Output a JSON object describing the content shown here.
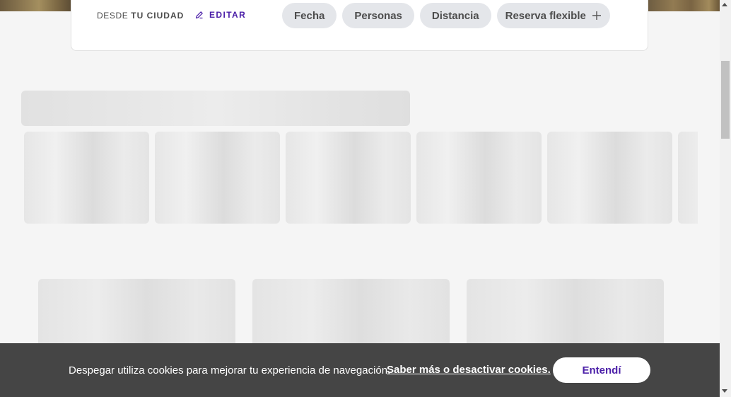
{
  "search": {
    "origin_prefix": "DESDE",
    "origin_city": "TU CIUDAD",
    "edit_label": "EDITAR",
    "filters": [
      {
        "label": "Fecha"
      },
      {
        "label": "Personas"
      },
      {
        "label": "Distancia"
      },
      {
        "label": "Reserva flexible",
        "icon": "plus-icon"
      }
    ]
  },
  "cookie_banner": {
    "message": "Despegar utiliza cookies para mejorar tu experiencia de navegación.",
    "link": "Saber más o desactivar cookies.",
    "accept": "Entendí"
  },
  "colors": {
    "accent": "#4b1fa8",
    "chip_bg": "#e4e6ea",
    "banner_bg": "#454545",
    "page_bg": "#f5f5f5"
  }
}
